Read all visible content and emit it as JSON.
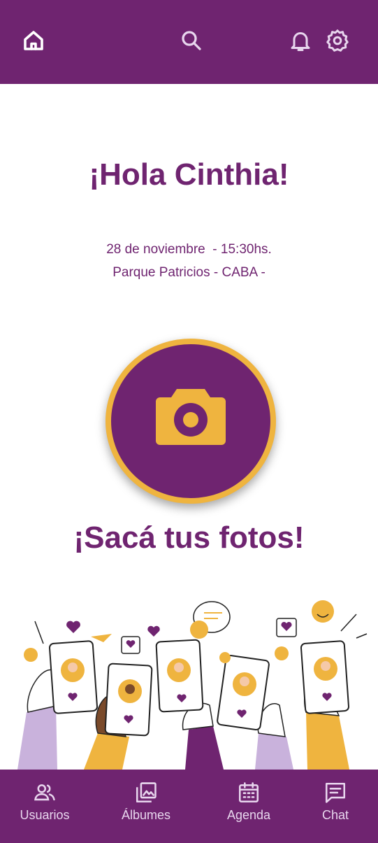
{
  "header": {
    "icons": [
      "home-icon",
      "search-icon",
      "bell-icon",
      "gear-icon"
    ]
  },
  "main": {
    "greeting": "¡Hola Cinthia!",
    "event_date": "28 de noviembre  - 15:30hs.",
    "event_place": "Parque Patricios - CABA -",
    "camera_icon": "camera-icon",
    "cta": "¡Sacá tus fotos!"
  },
  "bottom_nav": {
    "items": [
      {
        "label": "Usuarios",
        "icon": "users-icon"
      },
      {
        "label": "Álbumes",
        "icon": "albums-icon"
      },
      {
        "label": "Agenda",
        "icon": "calendar-icon"
      },
      {
        "label": "Chat",
        "icon": "chat-icon"
      }
    ]
  },
  "colors": {
    "brand_purple": "#6f2470",
    "accent_yellow": "#efb43f",
    "background": "#ffffff"
  }
}
